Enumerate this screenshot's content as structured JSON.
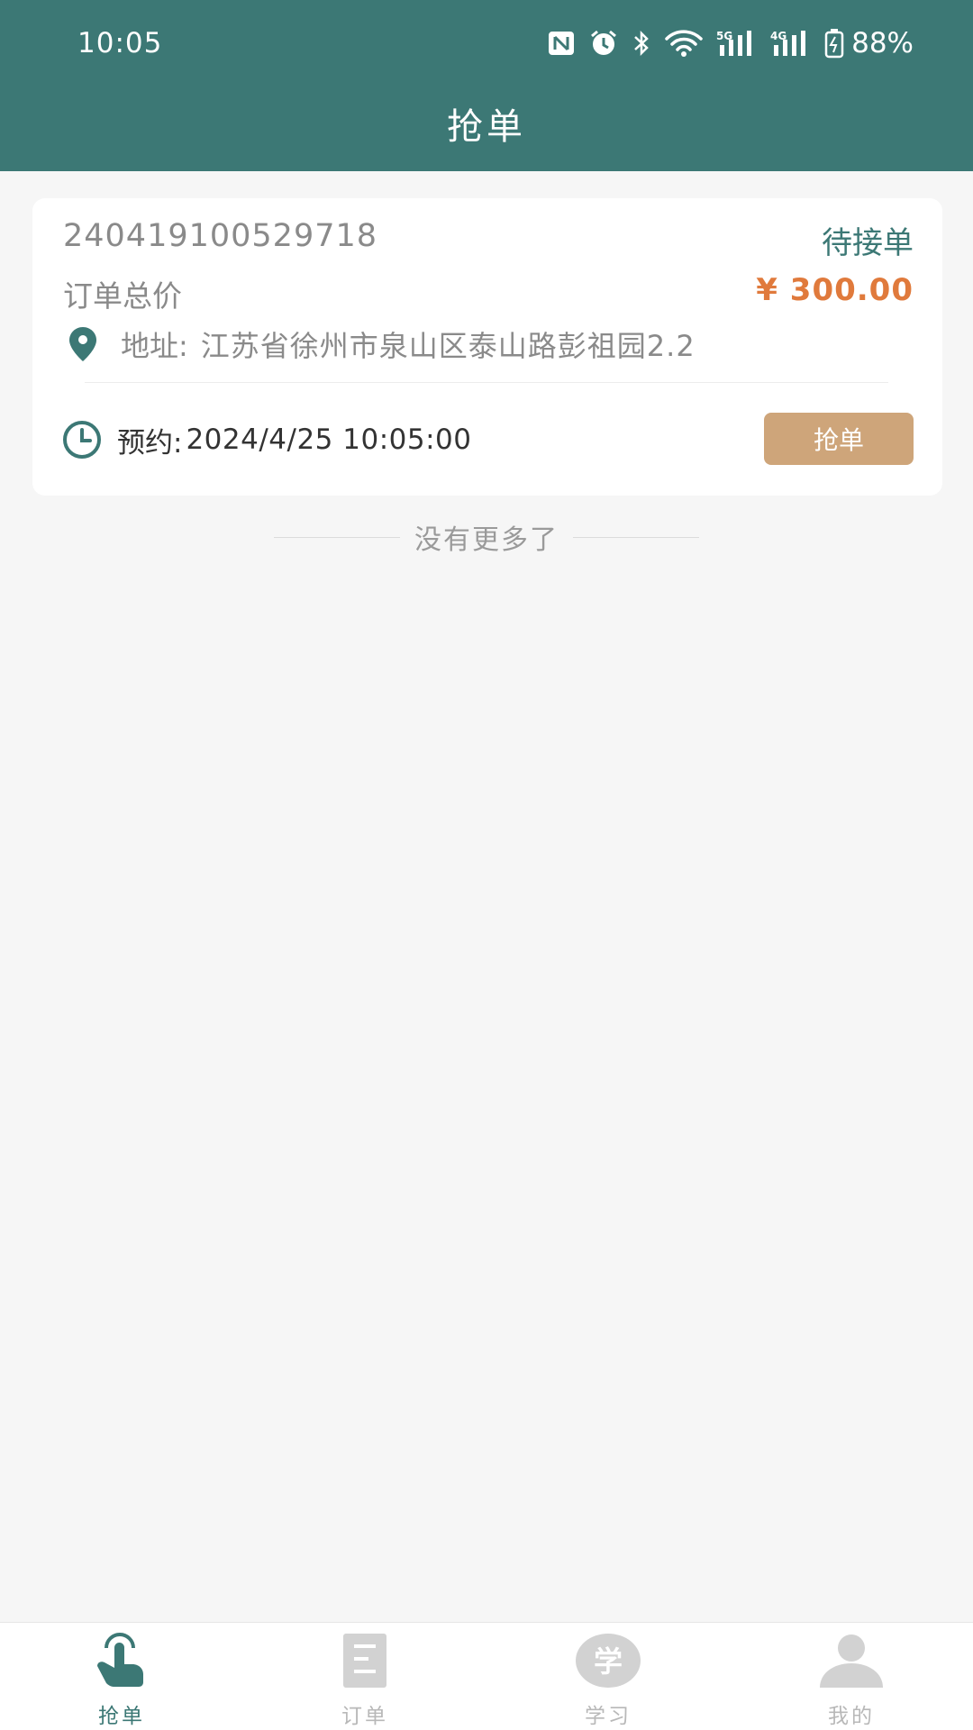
{
  "status_bar": {
    "time": "10:05",
    "battery": "88%",
    "icons": [
      "nfc-icon",
      "alarm-icon",
      "bluetooth-icon",
      "wifi-icon",
      "signal-5g-icon",
      "signal-4g-icon",
      "battery-icon"
    ]
  },
  "header": {
    "title": "抢单"
  },
  "orders": [
    {
      "id": "240419100529718",
      "status": "待接单",
      "total_label": "订单总价",
      "total_price": "¥ 300.00",
      "address_label": "地址:",
      "address": "江苏省徐州市泉山区泰山路彭祖园2.2",
      "booking_label": "预约:",
      "booking_time": "2024/4/25 10:05:00",
      "action_label": "抢单"
    }
  ],
  "list_footer": "没有更多了",
  "tabbar": {
    "active": "grab",
    "items": [
      {
        "key": "grab",
        "label": "抢单",
        "icon": "hand-tap-icon"
      },
      {
        "key": "orders",
        "label": "订单",
        "icon": "document-icon"
      },
      {
        "key": "study",
        "label": "学习",
        "icon": "study-icon"
      },
      {
        "key": "mine",
        "label": "我的",
        "icon": "user-icon"
      }
    ]
  },
  "colors": {
    "primary": "#3c7875",
    "accent_price": "#e07a3c",
    "button": "#cea57a",
    "background": "#f6f6f6",
    "inactive": "#d2d2d2"
  }
}
